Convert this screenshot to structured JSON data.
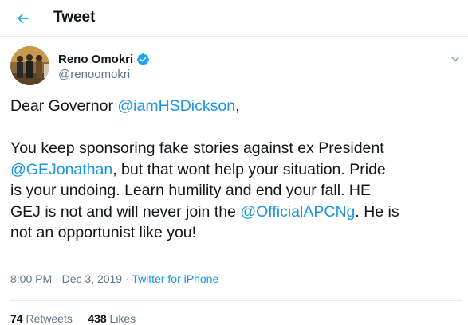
{
  "header": {
    "title": "Tweet"
  },
  "tweet": {
    "author": {
      "name": "Reno Omokri",
      "handle": "@renoomokri"
    },
    "body": {
      "line1_prefix": "Dear Governor ",
      "mention1": "@iamHSDickson",
      "line1_suffix": ",",
      "para2_text1": "You keep sponsoring fake stories against ex President\n",
      "mention2": "@GEJonathan",
      "para2_text2": ", but that wont help your situation. Pride\nis your undoing. Learn humility and end your fall. HE\nGEJ is not and will never join the ",
      "mention3": "@OfficialAPCNg",
      "para2_text3": ". He is\nnot an opportunist like you!"
    },
    "time": "8:00 PM",
    "separator": " · ",
    "date": "Dec 3, 2019",
    "separator2": " · ",
    "source": "Twitter for iPhone",
    "retweets_count": "74",
    "retweets_label": "Retweets",
    "likes_count": "438",
    "likes_label": "Likes"
  },
  "colors": {
    "link": "#1b95e0",
    "muted": "#657786",
    "text": "#14171a",
    "verified": "#1da1f2"
  },
  "icons": {
    "back": "arrow-left-icon",
    "verified": "verified-badge-icon",
    "menu": "chevron-down-icon"
  }
}
